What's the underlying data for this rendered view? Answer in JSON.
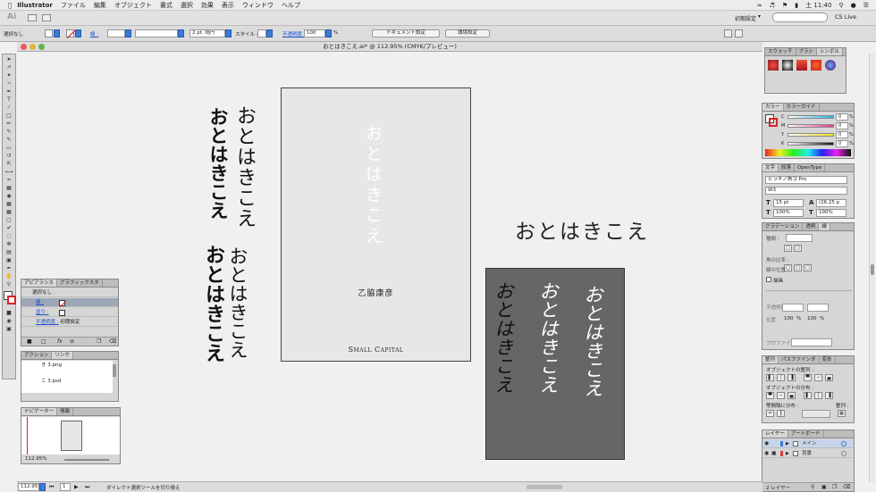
{
  "menubar": {
    "app_name": "Illustrator",
    "items": [
      "ファイル",
      "編集",
      "オブジェクト",
      "書式",
      "選択",
      "効果",
      "表示",
      "ウィンドウ",
      "ヘルプ"
    ],
    "clock": "土 11:40"
  },
  "appbar": {
    "ai_badge": "Ai",
    "workspace": "初期設定",
    "cs_live": "CS Live"
  },
  "ctrlbar": {
    "selection_label": "選択なし",
    "stroke_label": "線 :",
    "brush_value": "2 pt. 楕円",
    "style_label": "スタイル :",
    "opacity_label": "不透明度 :",
    "opacity_value": "100",
    "opacity_unit": "%",
    "doc_setup_button": "ドキュメント設定",
    "env_setup_button": "環境設定"
  },
  "document": {
    "title": "おとはきこえ.ai* @ 112.95% (CMYK/プレビュー)"
  },
  "artwork": {
    "text_light": "おとはきこえ",
    "text_bold": "おとはきこえ",
    "cover_title": "おとはきこえ",
    "cover_author": "乙脇康彦",
    "cover_publisher": "Small Capital",
    "glyph_text": "おとはきこえ",
    "hand_text": "おとはきこえ"
  },
  "appearance_panel": {
    "tabs": [
      "アピアランス",
      "グラフィックスタ"
    ],
    "selection": "選択なし",
    "stroke_row": "線 :",
    "fill_row": "塗り :",
    "opacity_row": "不透明度 :",
    "opacity_value": "初期設定"
  },
  "links_panel": {
    "tabs": [
      "アクション",
      "リンク"
    ],
    "files": [
      "き 3.png",
      "こ 3.psd"
    ]
  },
  "navigator_panel": {
    "tabs": [
      "ナビゲーター",
      "情報"
    ],
    "zoom": "112.95%"
  },
  "swatches_panel": {
    "tabs": [
      "スウォッチ",
      "ブラシ",
      "シンボル"
    ]
  },
  "color_panel": {
    "tabs": [
      "カラー",
      "カラーガイド"
    ],
    "channels": [
      {
        "name": "C",
        "value": "0",
        "unit": "%",
        "color": "#24b3e8"
      },
      {
        "name": "M",
        "value": "0",
        "unit": "%",
        "color": "#e83a8e"
      },
      {
        "name": "Y",
        "value": "0",
        "unit": "%",
        "color": "#f2e01c"
      },
      {
        "name": "K",
        "value": "0",
        "unit": "%",
        "color": "#111111"
      }
    ]
  },
  "type_panel": {
    "tabs": [
      "文字",
      "段落",
      "OpenType"
    ],
    "font": "ヒラギノ角ゴ Pro",
    "weight": "W3",
    "size": "15 pt",
    "leading": "(26.25 p",
    "kerning": "100%",
    "tracking": "100%"
  },
  "gradient_panel": {
    "tabs": [
      "グラデーション",
      "透明",
      "線"
    ],
    "type_label": "種類 :",
    "angle_label": "角の比率 :",
    "stroke_label": "線の位置 :",
    "blend_label": "描画",
    "opacity_label": "不透明度",
    "position_label": "位置 :",
    "vals": [
      "100",
      "%",
      "100",
      "%"
    ],
    "profile_label": "プロファイル :"
  },
  "align_panel": {
    "tabs": [
      "整列",
      "パスファインダ",
      "変形"
    ],
    "align_objects": "オブジェクトの整列 :",
    "distribute_objects": "オブジェクトの分布 :",
    "distribute_spacing": "等間隔に分布 :",
    "align_to": "整列 :"
  },
  "layers_panel": {
    "tabs": [
      "レイヤー",
      "アートボード"
    ],
    "layers": [
      {
        "name": "メイン",
        "color": "#3a7ad8"
      },
      {
        "name": "背景",
        "color": "#d83a3a"
      }
    ],
    "footer": "2 レイヤー"
  },
  "statusbar": {
    "zoom": "112.95%",
    "artboard": "1",
    "tool_hint": "ダイレクト選択ツールを切り換え"
  }
}
